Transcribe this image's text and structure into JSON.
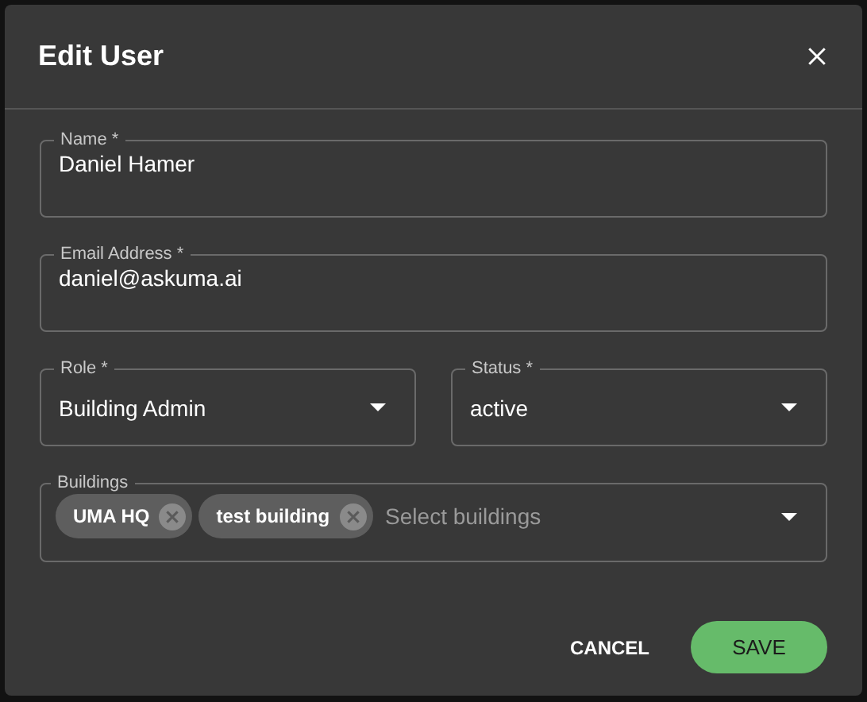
{
  "dialog": {
    "title": "Edit User"
  },
  "fields": [
    {
      "kind": "text",
      "label": "Name *",
      "value": "Daniel Hamer"
    },
    {
      "kind": "text",
      "label": "Email Address *",
      "value": "daniel@askuma.ai"
    }
  ],
  "selects": [
    {
      "label": "Role *",
      "value": "Building Admin"
    },
    {
      "label": "Status *",
      "value": "active"
    }
  ],
  "buildings": {
    "label": "Buildings",
    "chips": [
      "UMA HQ",
      "test building"
    ],
    "placeholder": "Select buildings"
  },
  "buttons": [
    {
      "kind": "text",
      "label": "CANCEL"
    },
    {
      "kind": "primary",
      "label": "SAVE"
    }
  ]
}
